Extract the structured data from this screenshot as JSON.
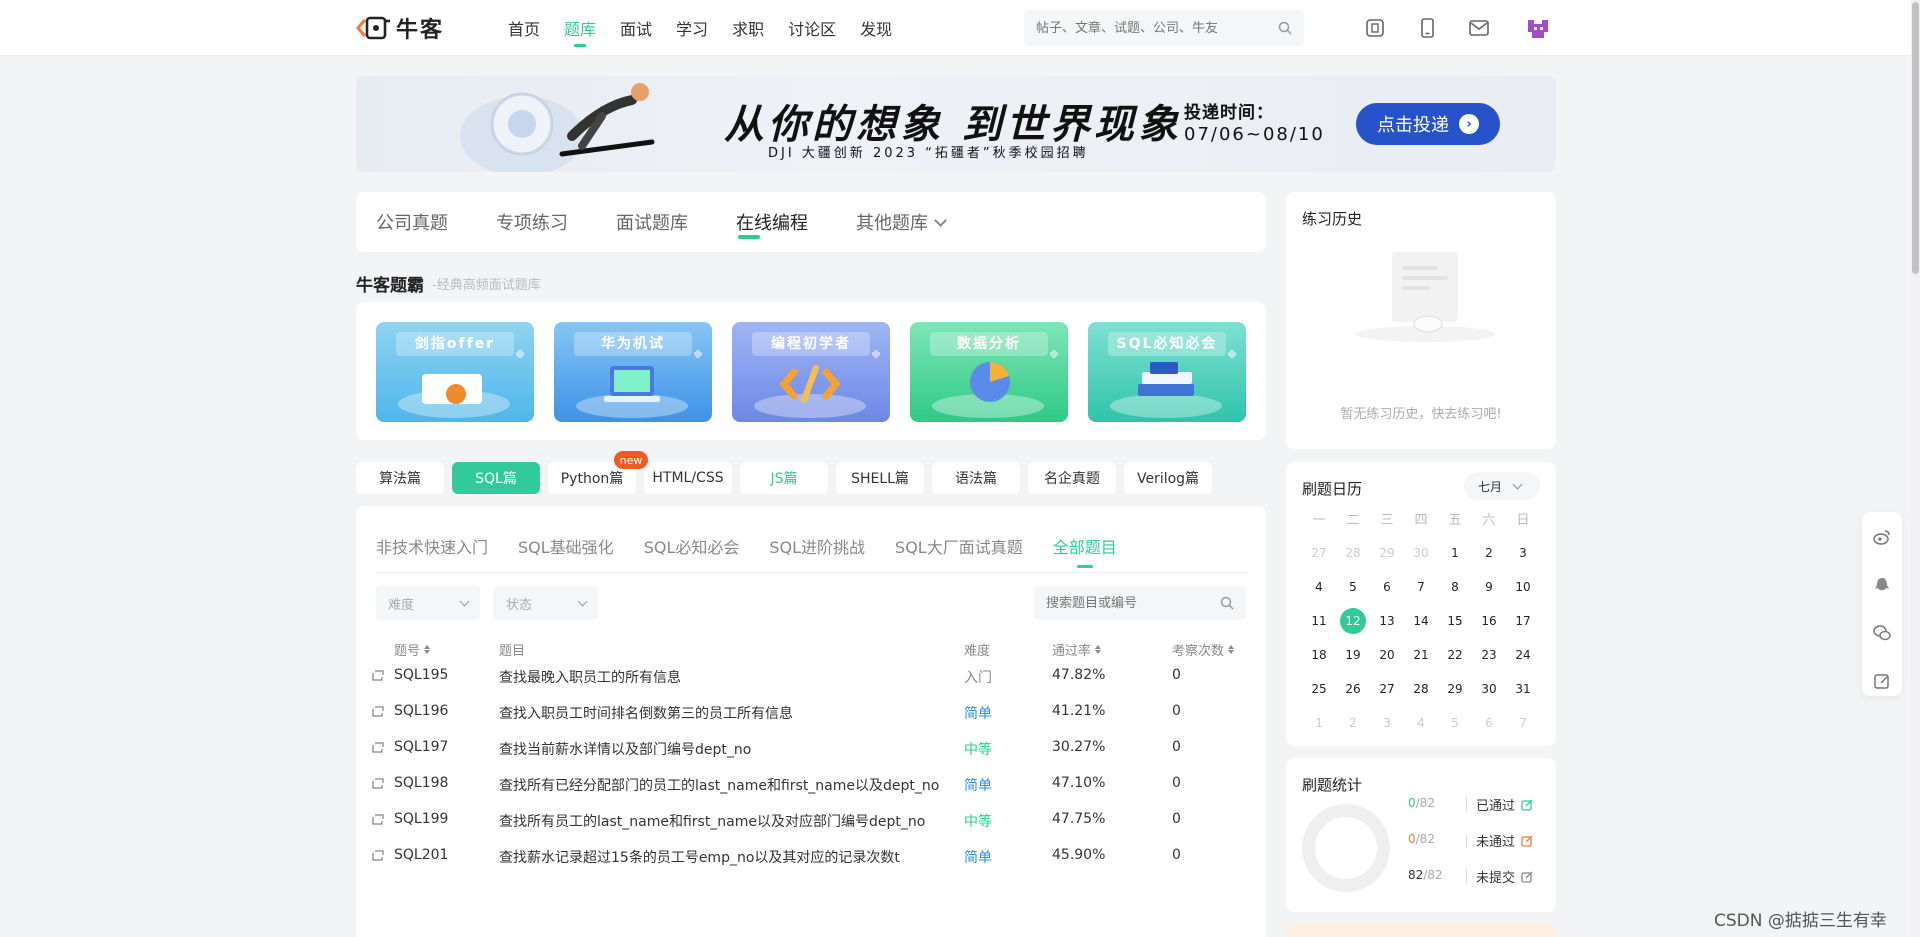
{
  "header": {
    "logo_text": "牛客",
    "nav": [
      "首页",
      "题库",
      "面试",
      "学习",
      "求职",
      "讨论区",
      "发现"
    ],
    "active_nav": "题库",
    "search_placeholder": "帖子、文章、试题、公司、牛友",
    "icons": [
      "scan-icon",
      "mobile-icon",
      "mail-icon"
    ]
  },
  "banner": {
    "title": "从你的想象 到世界现象",
    "subtitle": "DJI 大疆创新 2023 “拓疆者”秋季校园招聘",
    "time_label": "投递时间：",
    "time_range": "07/06~08/10",
    "button": "点击投递"
  },
  "main_tabs": [
    "公司真题",
    "专项练习",
    "面试题库",
    "在线编程",
    "其他题库"
  ],
  "active_main_tab": "在线编程",
  "section": {
    "title": "牛客题霸",
    "subtitle": "-经典高频面试题库"
  },
  "topics": [
    "剑指offer",
    "华为机试",
    "编程初学者",
    "数据分析",
    "SQL必知必会"
  ],
  "languages": [
    "算法篇",
    "SQL篇",
    "Python篇",
    "HTML/CSS",
    "JS篇",
    "SHELL篇",
    "语法篇",
    "名企真题",
    "Verilog篇"
  ],
  "active_language": "SQL篇",
  "new_badge": "new",
  "sub_tabs": [
    "非技术快速入门",
    "SQL基础强化",
    "SQL必知必会",
    "SQL进阶挑战",
    "SQL大厂面试真题",
    "全部题目"
  ],
  "active_sub_tab": "全部题目",
  "filters": {
    "difficulty": "难度",
    "status": "状态",
    "search_placeholder": "搜索题目或编号"
  },
  "table": {
    "headers": [
      "题号",
      "题目",
      "难度",
      "通过率",
      "考察次数"
    ],
    "rows": [
      {
        "id": "SQL195",
        "title": "查找最晚入职员工的所有信息",
        "difficulty": "入门",
        "pass_rate": "47.82%",
        "count": "0"
      },
      {
        "id": "SQL196",
        "title": "查找入职员工时间排名倒数第三的员工所有信息",
        "difficulty": "简单",
        "pass_rate": "41.21%",
        "count": "0"
      },
      {
        "id": "SQL197",
        "title": "查找当前薪水详情以及部门编号dept_no",
        "difficulty": "中等",
        "pass_rate": "30.27%",
        "count": "0"
      },
      {
        "id": "SQL198",
        "title": "查找所有已经分配部门的员工的last_name和first_name以及dept_no",
        "difficulty": "简单",
        "pass_rate": "47.10%",
        "count": "0"
      },
      {
        "id": "SQL199",
        "title": "查找所有员工的last_name和first_name以及对应部门编号dept_no",
        "difficulty": "中等",
        "pass_rate": "47.75%",
        "count": "0"
      },
      {
        "id": "SQL201",
        "title": "查找薪水记录超过15条的员工号emp_no以及其对应的记录次数t",
        "difficulty": "简单",
        "pass_rate": "45.90%",
        "count": "0"
      }
    ]
  },
  "history": {
    "title": "练习历史",
    "empty_text": "暂无练习历史，快去练习吧!"
  },
  "calendar": {
    "title": "刷题日历",
    "month": "七月",
    "weekdays": [
      "一",
      "二",
      "三",
      "四",
      "五",
      "六",
      "日"
    ],
    "days": [
      "27",
      "28",
      "29",
      "30",
      "1",
      "2",
      "3",
      "4",
      "5",
      "6",
      "7",
      "8",
      "9",
      "10",
      "11",
      "12",
      "13",
      "14",
      "15",
      "16",
      "17",
      "18",
      "19",
      "20",
      "21",
      "22",
      "23",
      "24",
      "25",
      "26",
      "27",
      "28",
      "29",
      "30",
      "31",
      "1",
      "2",
      "3",
      "4",
      "5",
      "6",
      "7"
    ],
    "today": "12"
  },
  "stats": {
    "title": "刷题统计",
    "items": [
      {
        "num": "0",
        "total": "/82",
        "label": "已通过",
        "color": "#32ca99"
      },
      {
        "num": "0",
        "total": "/82",
        "label": "未通过",
        "color": "#f07a3a"
      },
      {
        "num": "82",
        "total": "/82",
        "label": "未提交",
        "color": "#333333"
      }
    ]
  },
  "float_icons": [
    "weibo-icon",
    "qq-icon",
    "wechat-icon",
    "feedback-icon"
  ],
  "watermark": "CSDN @掂掂三生有幸"
}
